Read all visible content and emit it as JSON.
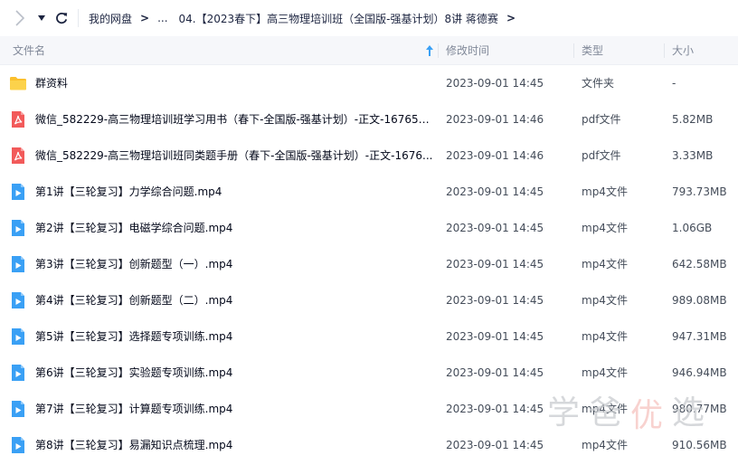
{
  "breadcrumb": {
    "root": "我的网盘",
    "ellipsis": "...",
    "current": "04.【2023春下】高三物理培训班（全国版-强基计划）8讲 蒋德赛"
  },
  "columns": {
    "name": "文件名",
    "modified": "修改时间",
    "type": "类型",
    "size": "大小"
  },
  "files": [
    {
      "icon": "folder-icon",
      "name": "群资料",
      "time": "2023-09-01 14:45",
      "type": "文件夹",
      "size": "-"
    },
    {
      "icon": "pdf-icon",
      "name": "微信_582229-高三物理培训班学习用书（春下-全国版-强基计划）-正文-167653...",
      "time": "2023-09-01 14:46",
      "type": "pdf文件",
      "size": "5.82MB"
    },
    {
      "icon": "pdf-icon",
      "name": "微信_582229-高三物理培训班同类题手册（春下-全国版-强基计划）-正文-1676...",
      "time": "2023-09-01 14:46",
      "type": "pdf文件",
      "size": "3.33MB"
    },
    {
      "icon": "video-icon",
      "name": "第1讲【三轮复习】力学综合问题.mp4",
      "time": "2023-09-01 14:45",
      "type": "mp4文件",
      "size": "793.73MB"
    },
    {
      "icon": "video-icon",
      "name": "第2讲【三轮复习】电磁学综合问题.mp4",
      "time": "2023-09-01 14:45",
      "type": "mp4文件",
      "size": "1.06GB"
    },
    {
      "icon": "video-icon",
      "name": "第3讲【三轮复习】创新题型（一）.mp4",
      "time": "2023-09-01 14:45",
      "type": "mp4文件",
      "size": "642.58MB"
    },
    {
      "icon": "video-icon",
      "name": "第4讲【三轮复习】创新题型（二）.mp4",
      "time": "2023-09-01 14:45",
      "type": "mp4文件",
      "size": "989.08MB"
    },
    {
      "icon": "video-icon",
      "name": "第5讲【三轮复习】选择题专项训练.mp4",
      "time": "2023-09-01 14:45",
      "type": "mp4文件",
      "size": "947.31MB"
    },
    {
      "icon": "video-icon",
      "name": "第6讲【三轮复习】实验题专项训练.mp4",
      "time": "2023-09-01 14:45",
      "type": "mp4文件",
      "size": "946.94MB"
    },
    {
      "icon": "video-icon",
      "name": "第7讲【三轮复习】计算题专项训练.mp4",
      "time": "2023-09-01 14:45",
      "type": "mp4文件",
      "size": "980.77MB"
    },
    {
      "icon": "video-icon",
      "name": "第8讲【三轮复习】易漏知识点梳理.mp4",
      "time": "2023-09-01 14:45",
      "type": "mp4文件",
      "size": "910.56MB"
    }
  ],
  "watermark": {
    "chars": [
      "学",
      "爸",
      "优",
      "选"
    ]
  },
  "colors": {
    "folder": "#fbc02d",
    "pdf": "#f25a5a",
    "video": "#3aa0f5"
  }
}
